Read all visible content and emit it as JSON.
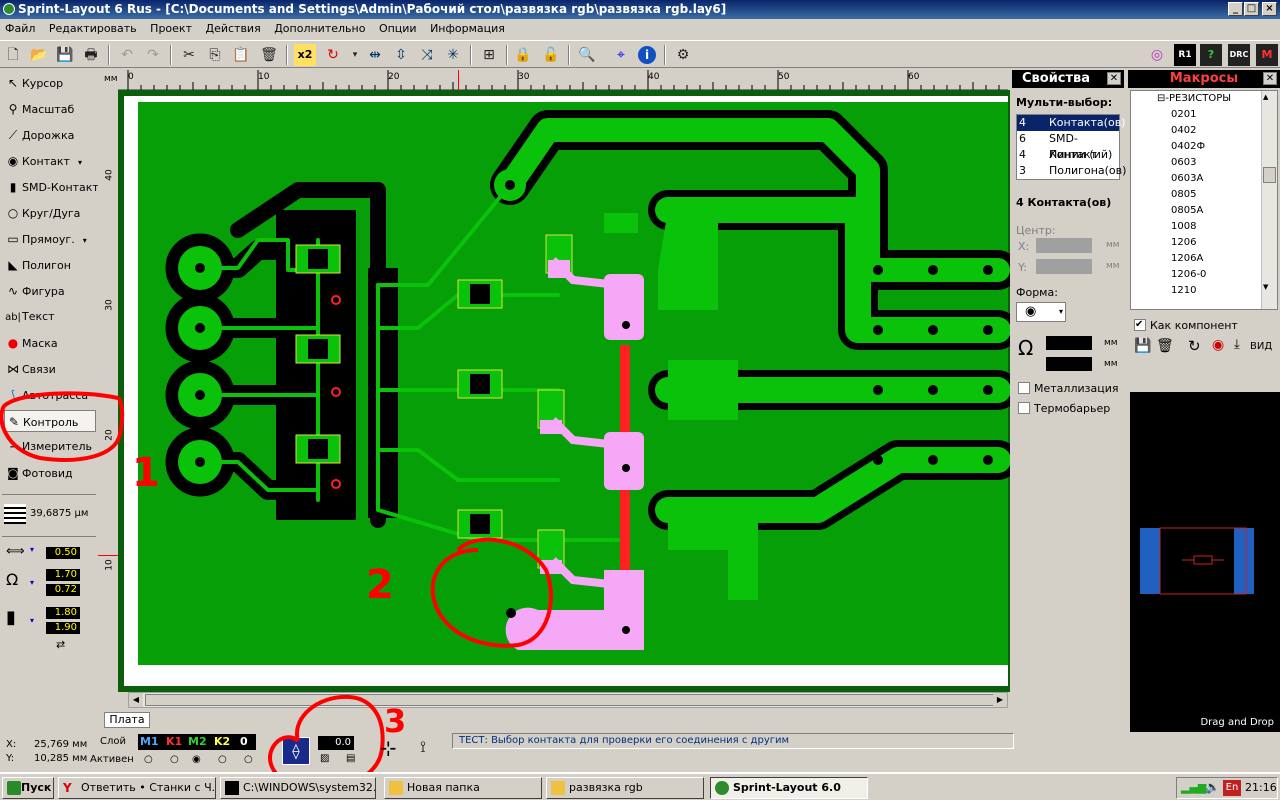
{
  "window": {
    "title": "Sprint-Layout 6 Rus - [C:\\Documents and Settings\\Admin\\Рабочий стол\\развязка rgb\\развязка rgb.lay6]"
  },
  "menu": [
    "Файл",
    "Редактировать",
    "Проект",
    "Действия",
    "Дополнительно",
    "Опции",
    "Информация"
  ],
  "toolbar": {
    "zoom_label": "x2"
  },
  "tools": [
    {
      "label": "Курсор",
      "icon": "cursor-icon"
    },
    {
      "label": "Масштаб",
      "icon": "magnifier-icon"
    },
    {
      "label": "Дорожка",
      "icon": "track-icon"
    },
    {
      "label": "Контакт",
      "icon": "pad-icon"
    },
    {
      "label": "SMD-Контакт",
      "icon": "smd-pad-icon"
    },
    {
      "label": "Круг/Дуга",
      "icon": "circle-icon"
    },
    {
      "label": "Прямоуг.",
      "icon": "rectangle-icon"
    },
    {
      "label": "Полигон",
      "icon": "polygon-icon"
    },
    {
      "label": "Фигура",
      "icon": "shape-icon"
    },
    {
      "label": "Текст",
      "icon": "text-icon"
    },
    {
      "label": "Маска",
      "icon": "mask-icon"
    },
    {
      "label": "Связи",
      "icon": "connections-icon"
    },
    {
      "label": "Автотрасса",
      "icon": "autoroute-icon"
    },
    {
      "label": "Контроль",
      "icon": "test-probe-icon"
    },
    {
      "label": "Измеритель",
      "icon": "ruler-icon"
    },
    {
      "label": "Фотовид",
      "icon": "camera-icon"
    }
  ],
  "grid": {
    "value": "39,6875 µм"
  },
  "params": {
    "track_width": "0.50",
    "pad_outer": "1.70",
    "pad_inner": "0.72",
    "smd_w": "1.80",
    "smd_h": "1.90"
  },
  "ruler": {
    "unit": "мм",
    "top_ticks": [
      "0",
      "10",
      "20",
      "30",
      "40",
      "50",
      "60",
      "70"
    ],
    "left_ticks": [
      "40",
      "30",
      "20",
      "10"
    ]
  },
  "board": {
    "tab": "Плата"
  },
  "properties": {
    "title": "Свойства",
    "multi_select_label": "Мульти-выбор:",
    "multi_items": [
      {
        "count": "4",
        "name": "Контакта(ов)"
      },
      {
        "count": "6",
        "name": "SMD-Контакт"
      },
      {
        "count": "4",
        "name": "Линии (ий)"
      },
      {
        "count": "3",
        "name": "Полигона(ов)"
      }
    ],
    "selection_title": "4 Контакта(ов)",
    "center_label": "Центр:",
    "x_label": "X:",
    "y_label": "Y:",
    "unit": "мм",
    "form_label": "Форма:",
    "metallization": "Металлизация",
    "thermal": "Термобарьер"
  },
  "macros": {
    "title": "Макросы",
    "root": "РЕЗИСТОРЫ",
    "items": [
      "0201",
      "0402",
      "0402Ф",
      "0603",
      "0603А",
      "0805",
      "0805А",
      "1008",
      "1206",
      "1206А",
      "1206-0",
      "1210"
    ],
    "as_component": "Как компонент",
    "view_label": "ВИД",
    "drag_drop": "Drag and Drop"
  },
  "status": {
    "x_label": "X:",
    "x_value": "25,769 мм",
    "y_label": "Y:",
    "y_value": "10,285 мм",
    "layer_label": "Слой",
    "active_label": "Активен",
    "layers": [
      {
        "name": "M1",
        "color": "#4da6ff"
      },
      {
        "name": "K1",
        "color": "#ff3030"
      },
      {
        "name": "M2",
        "color": "#30d030"
      },
      {
        "name": "K2",
        "color": "#ffff40"
      },
      {
        "name": "0",
        "color": "#ffffff"
      }
    ],
    "offset_value": "0.0",
    "message": "ТЕСТ:  Выбор контакта для проверки его соединения с другим"
  },
  "annotations": [
    "1",
    "2",
    "3"
  ],
  "taskbar": {
    "start": "Пуск",
    "tasks": [
      "Ответить • Станки с Ч...",
      "C:\\WINDOWS\\system32...",
      "Новая папка",
      "развязка rgb",
      "Sprint-Layout 6.0"
    ],
    "lang": "En",
    "clock": "21:16"
  },
  "colors": {
    "board": "#079f07",
    "copper": "#0aa50a",
    "selection": "#f5a8f5",
    "highlight": "#ff2020",
    "annotation": "#ff0000"
  }
}
